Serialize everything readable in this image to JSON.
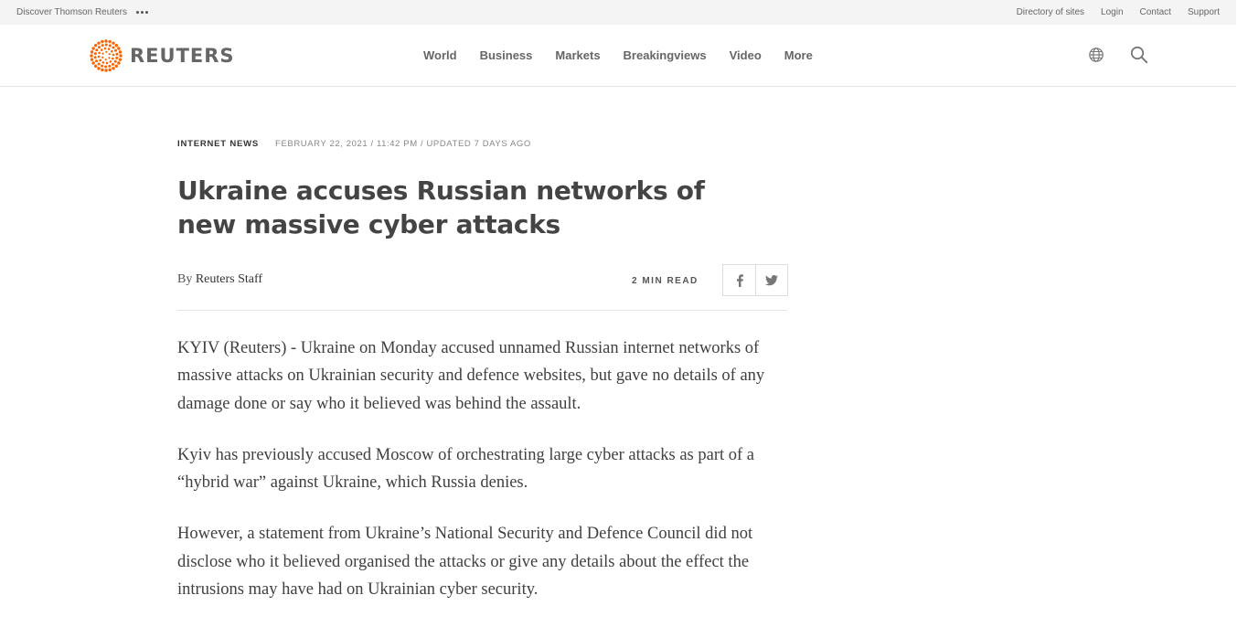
{
  "util_bar": {
    "discover_label": "Discover Thomson Reuters",
    "links": [
      "Directory of sites",
      "Login",
      "Contact",
      "Support"
    ]
  },
  "header": {
    "logo_text": "REUTERS",
    "nav": [
      "World",
      "Business",
      "Markets",
      "Breakingviews",
      "Video",
      "More"
    ],
    "icons": [
      "globe-icon",
      "search-icon"
    ]
  },
  "article": {
    "section": "Internet News",
    "dateline": "February 22, 2021 / 11:42 PM / Updated 7 days ago",
    "headline": "Ukraine accuses Russian networks of new massive cyber attacks",
    "byline_prefix": "By",
    "author": "Reuters Staff",
    "read_time": "2 Min Read",
    "share_icons": [
      "facebook-icon",
      "twitter-icon"
    ],
    "paragraphs": [
      "KYIV (Reuters) - Ukraine on Monday accused unnamed Russian internet networks of massive attacks on Ukrainian security and defence websites, but gave no details of any damage done or say who it believed was behind the assault.",
      "Kyiv has previously accused Moscow of orchestrating large cyber attacks as part of a “hybrid war” against Ukraine, which Russia denies.",
      "However, a statement from Ukraine’s National Security and Defence Council did not disclose who it believed organised the attacks or give any details about the effect the intrusions may have had on Ukrainian cyber security."
    ]
  },
  "colors": {
    "brand_orange": "#fa6400",
    "text": "#404040",
    "util_bg": "#f4f4f4"
  }
}
